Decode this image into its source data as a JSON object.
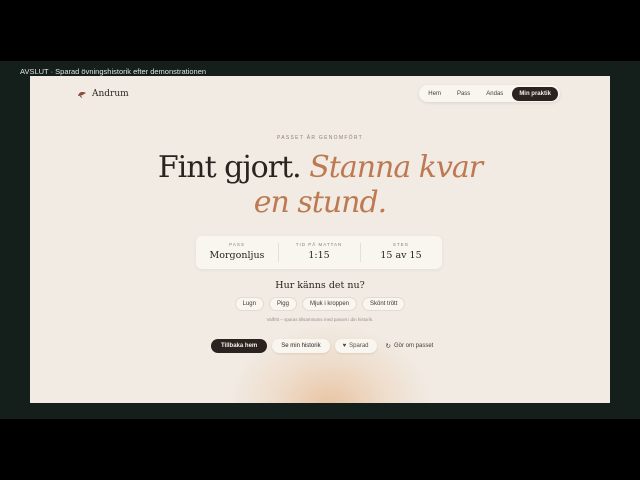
{
  "caption": "AVSLUT · Sparad övningshistorik efter demonstrationen",
  "brand": "Andrum",
  "nav": {
    "items": [
      "Hem",
      "Pass",
      "Andas",
      "Min praktik"
    ],
    "active_index": 3
  },
  "eyebrow": "PASSET ÄR GENOMFÖRT",
  "headline": {
    "part1": "Fint gjort.",
    "part2": "Stanna kvar",
    "part3": "en stund."
  },
  "stats": [
    {
      "label": "PASS",
      "value": "Morgonljus"
    },
    {
      "label": "TID PÅ MATTAN",
      "value": "1:15"
    },
    {
      "label": "STEG",
      "value": "15 av 15"
    }
  ],
  "question": "Hur känns det nu?",
  "moods": [
    "Lugn",
    "Pigg",
    "Mjuk i kroppen",
    "Skönt trött"
  ],
  "note": "Valfritt – sparas tillsammans med passet i din historik.",
  "actions": {
    "primary": "Tillbaka hem",
    "history": "Se min historik",
    "saved": "Sparad",
    "repeat": "Gör om passet"
  },
  "icons": {
    "logo": "leaf-bird-icon",
    "saved": "heart-icon",
    "repeat": "repeat-icon"
  },
  "colors": {
    "accent": "#bd7a52",
    "dark": "#2b231f",
    "background": "#f1ebe3",
    "frame": "#141f1c"
  }
}
